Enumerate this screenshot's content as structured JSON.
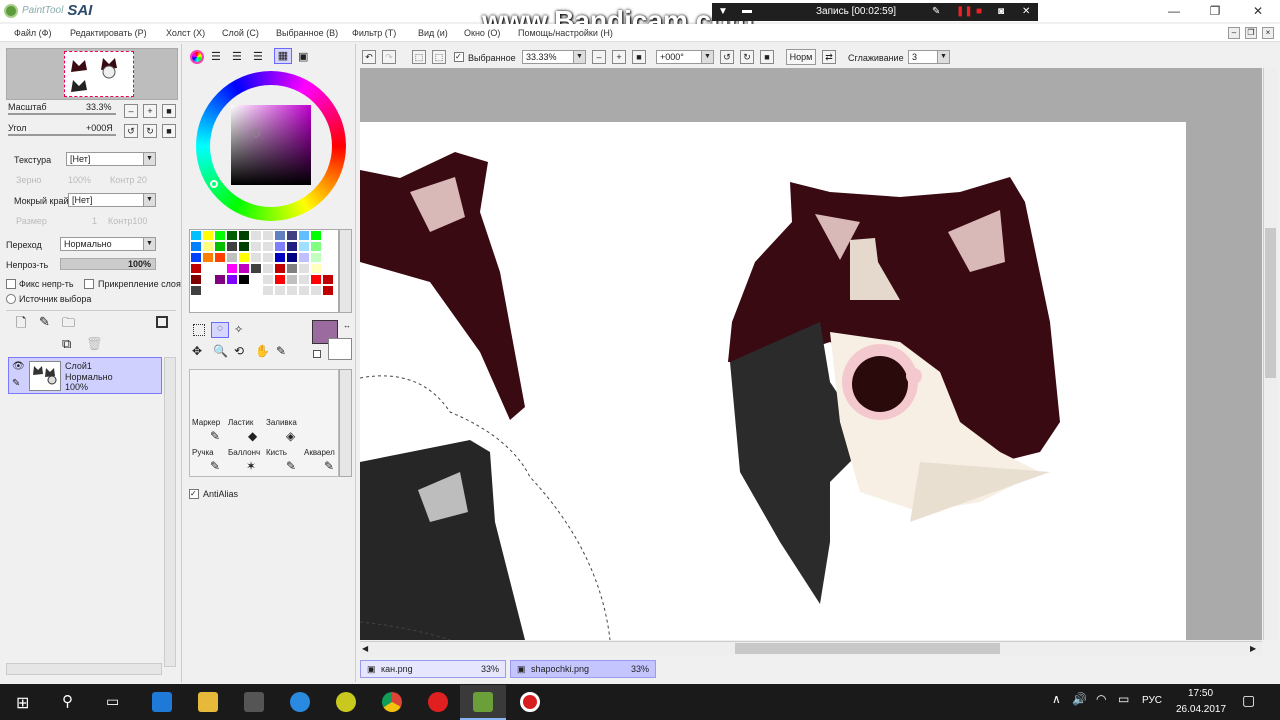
{
  "watermark": "www.Bandicam.com",
  "recorder": {
    "status": "Запись [00:02:59]"
  },
  "app": {
    "logo_top": "PaintTool",
    "logo_name": "SAI"
  },
  "menu": [
    "Файл (Ф)",
    "Редактировать (Р)",
    "Холст (Х)",
    "Слой (С)",
    "Выбранное (В)",
    "Фильтр (Т)",
    "Вид (и)",
    "Окно (О)",
    "Помощь/настройки (Н)"
  ],
  "navigator": {
    "zoom_label": "Масштаб",
    "zoom_value": "33.3%",
    "angle_label": "Угол",
    "angle_value": "+000Я"
  },
  "brush": {
    "texture_label": "Текстура",
    "texture_value": "[Нет]",
    "grain_label": "Зерно",
    "grain_value": "100%",
    "contrast": "Контр 20",
    "wet_label": "Мокрый край",
    "wet_value": "[Нет]",
    "size_label": "Размер",
    "size_value": "1",
    "contrast2": "Контр100"
  },
  "layer_opts": {
    "blend_label": "Переход",
    "blend_value": "Нормально",
    "opacity_label": "Непроз-ть",
    "opacity_value": "100%",
    "fix_opacity": "Фикс непр-ть",
    "clip_layer": "Прикрепление слоя",
    "selection_source": "Источник выбора"
  },
  "layer": {
    "name": "Слой1",
    "mode": "Нормально",
    "opacity": "100%"
  },
  "tools": {
    "marker": "Маркер",
    "eraser": "Ластик",
    "fill": "Заливка",
    "pen": "Ручка",
    "airbrush": "Баллонч",
    "brush": "Кисть",
    "watercolor": "Акварел"
  },
  "antialias": "AntiAlias",
  "toolbar": {
    "selection_label": "Выбранное",
    "zoom": "33.33%",
    "angle": "+000°",
    "norm_btn": "Норм",
    "smoothing_label": "Сглаживание",
    "smoothing_value": "3"
  },
  "tabs": [
    {
      "name": "кан.png",
      "zoom": "33%"
    },
    {
      "name": "shapochki.png",
      "zoom": "33%"
    }
  ],
  "taskbar": {
    "lang": "РУС",
    "time": "17:50",
    "date": "26.04.2017"
  },
  "colors": {
    "current": "#9b6a9e",
    "hat": "#3a0a12",
    "hat_ear_inner": "#d9b8b8",
    "selection": "#d0d0ff"
  },
  "swatches": [
    "#00c0ff",
    "#ffff00",
    "#00ff00",
    "#006000",
    "#004000",
    "#e0e0e0",
    "#e0e0e0",
    "#6080c0",
    "#404080",
    "#60c0ff",
    "#00ff00",
    "#ffffff",
    "#0080ff",
    "#ffff80",
    "#00c000",
    "#404040",
    "#004000",
    "#e0e0e0",
    "#e0e0e0",
    "#8080ff",
    "#202080",
    "#a0e0ff",
    "#80ff80",
    "#ffffff",
    "#0040ff",
    "#ff8000",
    "#ff4000",
    "#c0c0c0",
    "#ffff00",
    "#e0e0e0",
    "#e0e0e0",
    "#0000c0",
    "#000080",
    "#c0c0ff",
    "#c0ffc0",
    "#ffffff",
    "#c00000",
    "#ffffff",
    "#ffffff",
    "#ff00ff",
    "#c000c0",
    "#404040",
    "#e0e0e0",
    "#c00000",
    "#808080",
    "#e0e0e0",
    "#ffffc0",
    "#ffffff",
    "#800000",
    "#ffffff",
    "#800080",
    "#8000ff",
    "#000000",
    "#ffffff",
    "#e0e0e0",
    "#ff0000",
    "#c0c0c0",
    "#e0e0e0",
    "#ff0000",
    "#c00000",
    "#404040",
    "#ffffff",
    "#ffffff",
    "#ffffff",
    "#ffffff",
    "#ffffff",
    "#e0e0e0",
    "#e0e0e0",
    "#e0e0e0",
    "#e0e0e0",
    "#e0e0e0",
    "#c00000"
  ]
}
